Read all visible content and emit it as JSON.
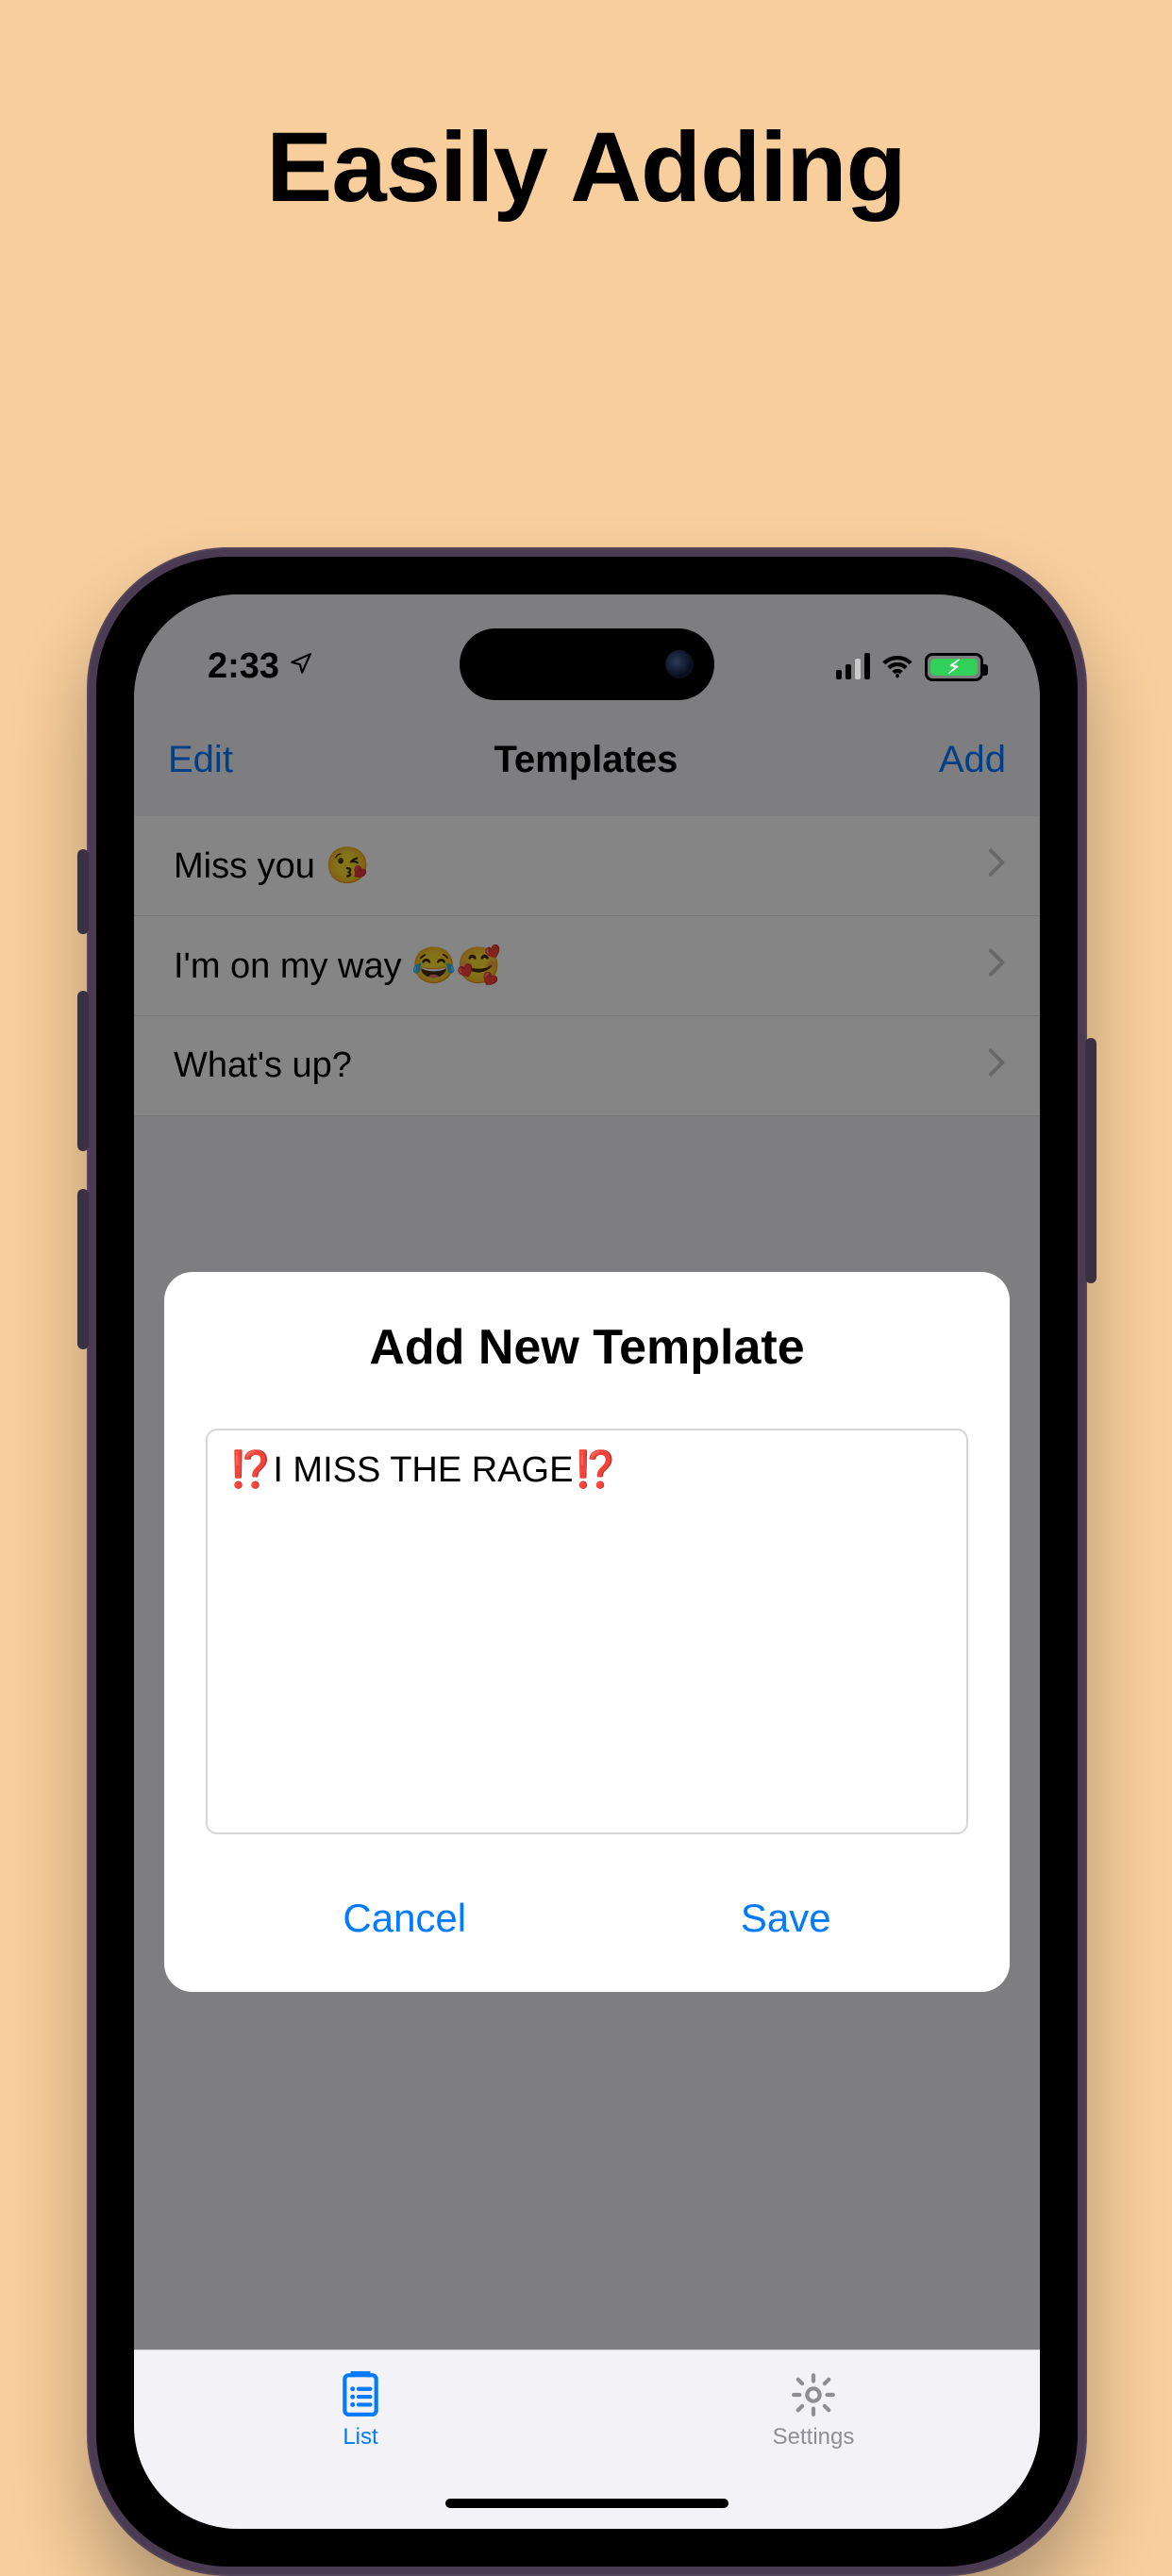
{
  "promo": {
    "title": "Easily Adding"
  },
  "status": {
    "time": "2:33"
  },
  "nav": {
    "left": "Edit",
    "title": "Templates",
    "right": "Add"
  },
  "templates": [
    {
      "text": "Miss you 😘"
    },
    {
      "text": "I'm on my way 😂🥰"
    },
    {
      "text": "What's up?"
    }
  ],
  "modal": {
    "title": "Add New Template",
    "input_value": "⁉️I MISS THE RAGE⁉️",
    "cancel": "Cancel",
    "save": "Save"
  },
  "tabs": {
    "list": "List",
    "settings": "Settings"
  }
}
